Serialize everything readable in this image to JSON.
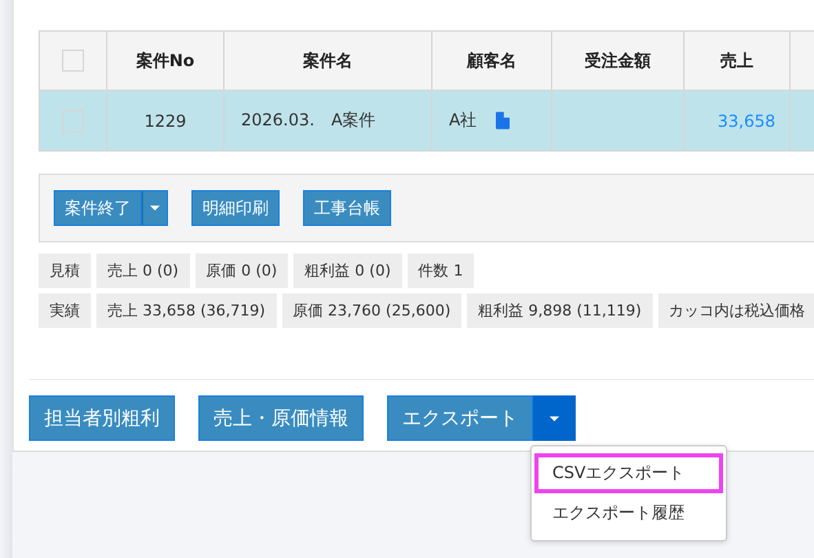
{
  "table": {
    "header_checkbox": {
      "checked": false
    },
    "columns": [
      "案件No",
      "案件名",
      "顧客名",
      "受注金額",
      "売上"
    ],
    "rows": [
      {
        "selected": true,
        "checked": false,
        "no": "1229",
        "name": "2026.03.　A案件",
        "customer": "A社",
        "sales": "33,658"
      }
    ]
  },
  "toolbar": {
    "buttons": [
      {
        "label": "案件終了",
        "has_dropdown": true
      },
      {
        "label": "明細印刷",
        "has_dropdown": false
      },
      {
        "label": "工事台帳",
        "has_dropdown": false
      }
    ]
  },
  "summary": [
    {
      "label": "見積",
      "items": [
        "売上 0 (0)",
        "原価 0 (0)",
        "粗利益 0 (0)",
        "件数 1"
      ]
    },
    {
      "label": "実績",
      "items": [
        "売上 33,658 (36,719)",
        "原価 23,760 (25,600)",
        "粗利益 9,898 (11,119)",
        "カッコ内は税込価格"
      ]
    }
  ],
  "actions": {
    "buttons": [
      "担当者別粗利",
      "売上・原価情報"
    ],
    "export": {
      "label": "エクスポート",
      "menu_open": true,
      "menu": [
        {
          "label": "CSVエクスポート",
          "highlighted": true
        },
        {
          "label": "エクスポート履歴",
          "highlighted": false
        }
      ]
    }
  }
}
